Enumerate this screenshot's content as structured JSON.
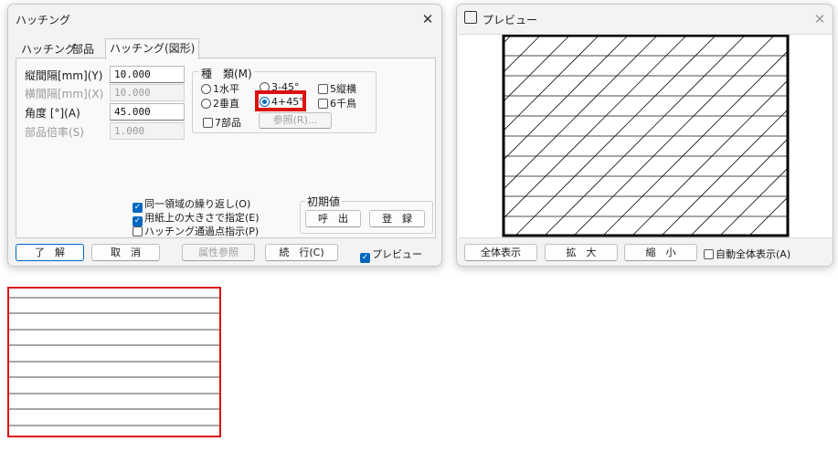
{
  "hatch_dialog": {
    "title": "ハッチング",
    "tabs": [
      "ハッチング",
      "部品",
      "ハッチング(図形)"
    ],
    "fields": {
      "vertical_pitch": {
        "label": "縦間隔[mm](Y)",
        "value": "10.000"
      },
      "horizontal_pitch": {
        "label": "横間隔[mm](X)",
        "value": "10.000"
      },
      "angle": {
        "label": "角度 [°](A)",
        "value": "45.000"
      },
      "part_scale": {
        "label": "部品倍率(S)",
        "value": "1.000"
      }
    },
    "type_group": {
      "label": "種　類(M)",
      "options": [
        "1水平",
        "2垂直",
        "3-45°",
        "4+45°",
        "5縦横",
        "6千鳥",
        "7部品"
      ],
      "selected": "4+45°",
      "reference_button": "参照(R)..."
    },
    "checkboxes": {
      "repeat_area": {
        "label": "同一領域の繰り返し(O)",
        "checked": true
      },
      "paper_size": {
        "label": "用紙上の大きさで指定(E)",
        "checked": true
      },
      "pass_point": {
        "label": "ハッチング通過点指示(P)",
        "checked": false
      }
    },
    "defaults_group": {
      "label": "初期値",
      "call_button": "呼　出",
      "register_button": "登　録"
    },
    "footer": {
      "ok": "了　解",
      "cancel": "取　消",
      "attribute_ref": "属性参照",
      "continue": "続　行(C)",
      "preview_label": "プレビュー",
      "preview_checked": true
    }
  },
  "preview_window": {
    "title": "プレビュー",
    "buttons": {
      "fit_all": "全体表示",
      "zoom_in": "拡　大",
      "zoom_out": "縮　小"
    },
    "auto_fit": {
      "label": "自動全体表示(A)",
      "checked": false
    }
  },
  "colors": {
    "accent": "#0067c0",
    "highlight_red": "#dd1111"
  }
}
